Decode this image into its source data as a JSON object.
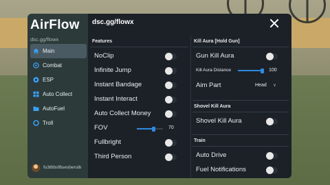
{
  "app": {
    "title": "AirFlow",
    "subtitle": "dsc.gg/flowx",
    "header_link": "dsc.gg/flowx"
  },
  "sidebar": {
    "items": [
      {
        "label": "Main",
        "icon": "home-icon",
        "active": true
      },
      {
        "label": "Combat",
        "icon": "crosshair-icon",
        "active": false
      },
      {
        "label": "ESP",
        "icon": "eye-icon",
        "active": false
      },
      {
        "label": "Auto Collect",
        "icon": "grid-icon",
        "active": false
      },
      {
        "label": "AutoFuel",
        "icon": "folder-icon",
        "active": false
      },
      {
        "label": "Troll",
        "icon": "circle-icon",
        "active": false
      }
    ],
    "username": "fu38tbsf8uesberuib"
  },
  "features": {
    "title": "Features",
    "noclip": "NoClip",
    "infinite_jump": "Infinite Jump",
    "instant_bandage": "Instant Bandage",
    "instant_interact": "Instant Interact",
    "auto_collect_money": "Auto Collect Money",
    "fov_label": "FOV",
    "fov_value": "70",
    "fullbright": "Fullbright",
    "third_person": "Third Person"
  },
  "kill_aura": {
    "title": "Kill Aura [Hold Gun]",
    "gun_kill_aura": "Gun Kill Aura",
    "distance_label": "Kill Aura Distance",
    "distance_value": "100",
    "aim_part_label": "Aim Part",
    "aim_part_value": "Head"
  },
  "shovel": {
    "title": "Shovel Kill Aura",
    "shovel_kill_aura": "Shovel Kill Aura"
  },
  "train": {
    "title": "Train",
    "auto_drive": "Auto Drive",
    "fuel_notifications": "Fuel Notifications"
  },
  "colors": {
    "accent": "#2f8ae0",
    "sidebar_bg": "#2c3a3a",
    "panel_bg": "#1c2127"
  }
}
